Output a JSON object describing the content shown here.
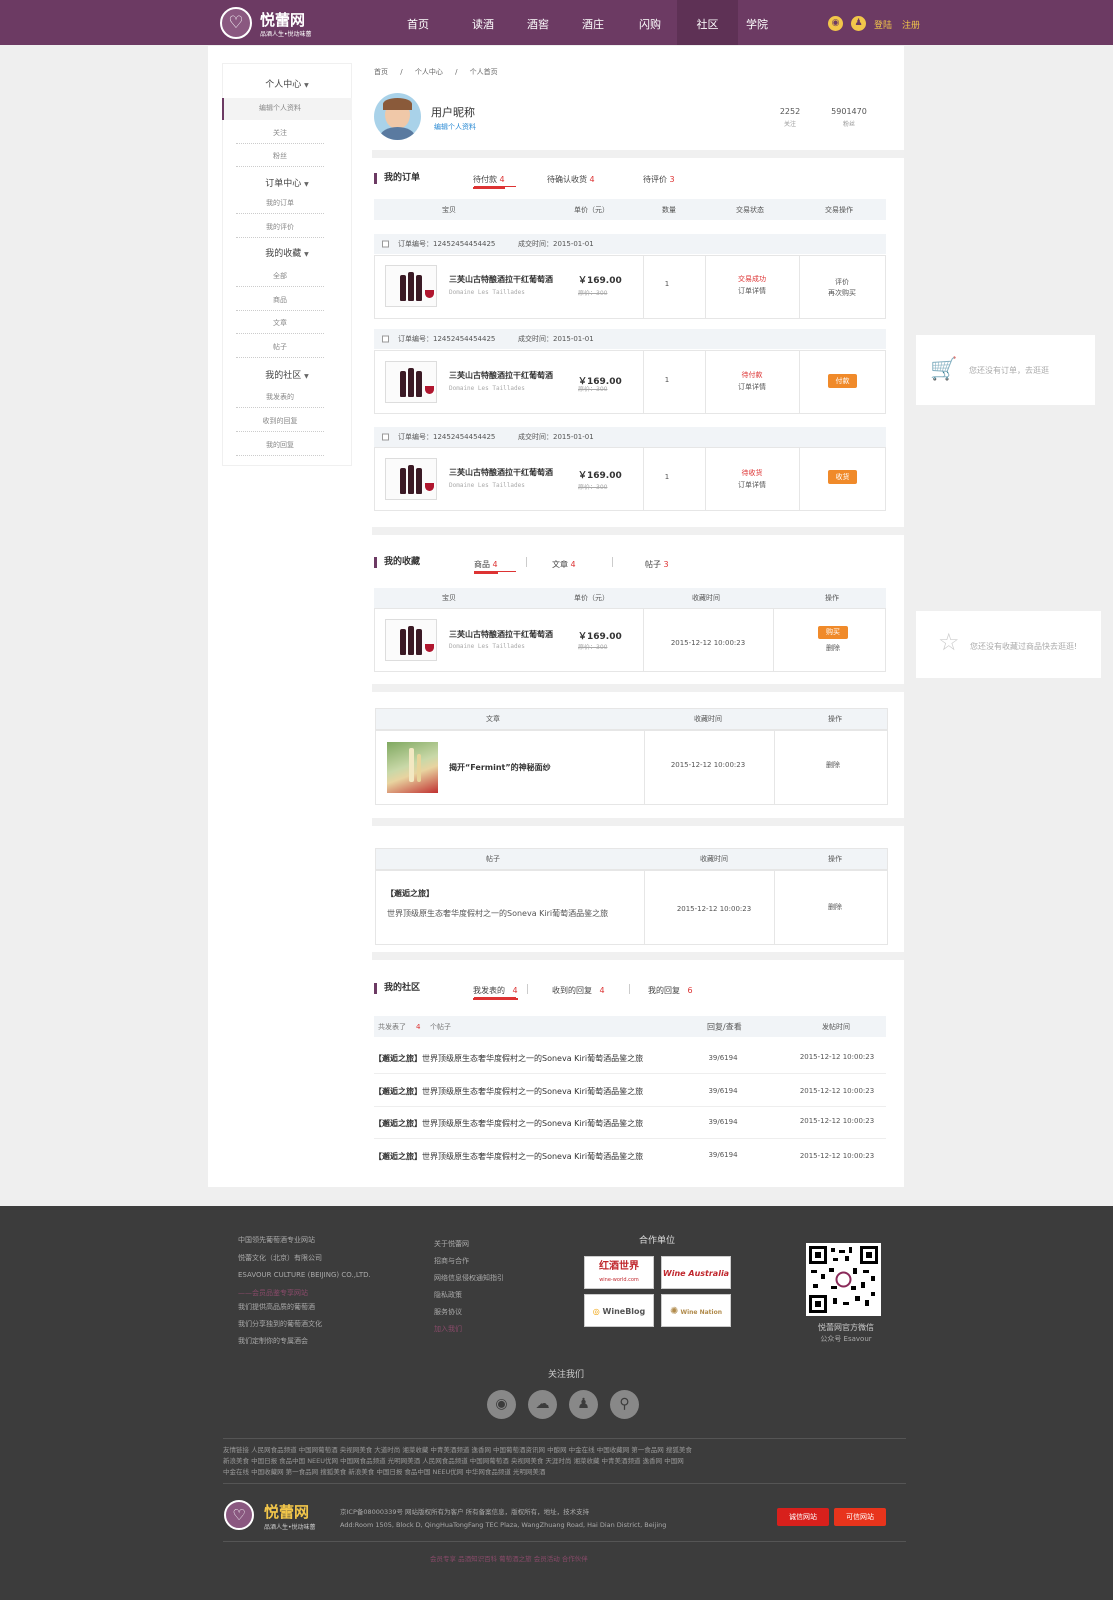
{
  "header": {
    "logo_text": "悦蕾网",
    "logo_slogan": "品酒人生•悦动味蕾",
    "nav": [
      "首页",
      "读酒",
      "酒窖",
      "酒庄",
      "闪购",
      "社区",
      "学院"
    ],
    "active_nav": "社区",
    "login": "登陆",
    "register": "注册"
  },
  "sidebar": {
    "personal_center": "个人中心",
    "personal_items": [
      "编辑个人资料",
      "关注",
      "粉丝"
    ],
    "order_center": "订单中心",
    "order_items": [
      "我的订单",
      "我的评价"
    ],
    "favorites": "我的收藏",
    "favorite_items": [
      "全部",
      "商品",
      "文章",
      "帖子"
    ],
    "community": "我的社区",
    "community_items": [
      "我发表的",
      "收到的回复",
      "我的回复"
    ]
  },
  "breadcrumb": [
    "首页",
    "个人中心",
    "个人首页"
  ],
  "profile": {
    "nickname": "用户昵称",
    "edit_link": "编辑个人资料",
    "follow_count": "2252",
    "follow_label": "关注",
    "fans_count": "5901470",
    "fans_label": "粉丝"
  },
  "orders": {
    "title": "我的订单",
    "tabs": [
      {
        "label": "待付款",
        "count": "4"
      },
      {
        "label": "待确认收货",
        "count": "4"
      },
      {
        "label": "待评价",
        "count": "3"
      }
    ],
    "headers": [
      "宝贝",
      "单价（元）",
      "数量",
      "交易状态",
      "交易操作"
    ],
    "items": [
      {
        "order_no": "订单编号：12452454454425",
        "order_time": "成交时间：2015-01-01",
        "name": "三芙山古特酿酒拉干红葡萄酒",
        "en": "Domaine Les Taillades",
        "price": "￥169.00",
        "orig": "原价：300",
        "qty": "1",
        "status": "交易成功",
        "detail": "订单详情",
        "op1": "评价",
        "op2": "再次购买"
      },
      {
        "order_no": "订单编号：12452454454425",
        "order_time": "成交时间：2015-01-01",
        "name": "三芙山古特酿酒拉干红葡萄酒",
        "en": "Domaine Les Taillades",
        "price": "￥169.00",
        "orig": "原价：300",
        "qty": "1",
        "status": "待付款",
        "detail": "订单详情",
        "button": "付款"
      },
      {
        "order_no": "订单编号：12452454454425",
        "order_time": "成交时间：2015-01-01",
        "name": "三芙山古特酿酒拉干红葡萄酒",
        "en": "Domaine Les Taillades",
        "price": "￥169.00",
        "orig": "原价：300",
        "qty": "1",
        "status": "待收货",
        "detail": "订单详情",
        "button": "收货"
      }
    ],
    "empty_note": "您还没有订单，去逛逛"
  },
  "favorites_sec": {
    "title": "我的收藏",
    "tabs": [
      {
        "label": "商品",
        "count": "4"
      },
      {
        "label": "文章",
        "count": "4"
      },
      {
        "label": "帖子",
        "count": "3"
      }
    ],
    "goods_headers": [
      "宝贝",
      "单价（元）",
      "收藏时间",
      "操作"
    ],
    "goods": {
      "name": "三芙山古特酿酒拉干红葡萄酒",
      "en": "Domaine Les Taillades",
      "price": "￥169.00",
      "orig": "原价：300",
      "time": "2015-12-12  10:00:23",
      "buy": "购买",
      "del": "删除"
    },
    "article_headers": [
      "文章",
      "收藏时间",
      "操作"
    ],
    "article": {
      "title": "揭开“Fermint”的神秘面纱",
      "time": "2015-12-12  10:00:23",
      "del": "删除"
    },
    "post_headers": [
      "帖子",
      "收藏时间",
      "操作"
    ],
    "post": {
      "title": "【邂逅之旅】",
      "text": "世界顶级原生态奢华度假村之一的Soneva Kiri葡萄酒品鉴之旅",
      "time": "2015-12-12  10:00:23",
      "del": "删除"
    },
    "empty_note": "您还没有收藏过商品快去逛逛!"
  },
  "community_sec": {
    "title": "我的社区",
    "tabs": [
      {
        "label": "我发表的",
        "count": "4"
      },
      {
        "label": "收到的回复",
        "count": "4"
      },
      {
        "label": "我的回复",
        "count": "6"
      }
    ],
    "summary_a": "共发表了",
    "summary_n": "4",
    "summary_b": "个帖子",
    "col_reply": "回复/查看",
    "col_time": "发帖时间",
    "rows": [
      {
        "tag": "【邂逅之旅】",
        "text": "世界顶级原生态奢华度假村之一的Soneva Kiri葡萄酒品鉴之旅",
        "stat": "39/6194",
        "time": "2015-12-12  10:00:23"
      },
      {
        "tag": "【邂逅之旅】",
        "text": "世界顶级原生态奢华度假村之一的Soneva Kiri葡萄酒品鉴之旅",
        "stat": "39/6194",
        "time": "2015-12-12  10:00:23"
      },
      {
        "tag": "【邂逅之旅】",
        "text": "世界顶级原生态奢华度假村之一的Soneva Kiri葡萄酒品鉴之旅",
        "stat": "39/6194",
        "time": "2015-12-12  10:00:23"
      },
      {
        "tag": "【邂逅之旅】",
        "text": "世界顶级原生态奢华度假村之一的Soneva Kiri葡萄酒品鉴之旅",
        "stat": "39/6194",
        "time": "2015-12-12  10:00:23"
      }
    ]
  },
  "footer": {
    "about": [
      "中国领先葡萄酒专业网站",
      "悦蕾文化（北京）有限公司",
      "ESAVOUR CULTURE (BEIJING) CO.,LTD."
    ],
    "about_pink": "——会员品鉴专享网站",
    "about_more": [
      "我们提供高品质的葡萄酒",
      "我们分享独到的葡萄酒文化",
      "我们定制你的专属酒会"
    ],
    "links": [
      "关于悦蕾网",
      "招商与合作",
      "网络信息侵权通知指引",
      "隐私政策",
      "服务协议"
    ],
    "links_pink": "加入我们",
    "partners_title": "合作单位",
    "partners": [
      "红酒世界",
      "Wine Australia",
      "WineBlog",
      "Wine Nation"
    ],
    "partner_subs": [
      "wine-world.com"
    ],
    "qr_title": "悦蕾网官方微信",
    "qr_sub": "公众号 Esavour",
    "follow_us": "关注我们",
    "friend_links_1": "友情链接   人民网食品频道     中国网葡萄酒     央视网美食     大道时尚     湘菜收藏     中青美酒频道     逸香网     中国葡萄酒资讯网     中酿网     中金在线     中国收藏网     第一食品网     搜狐美食",
    "friend_links_2": "新浪美食   中国日报     食品中国     NEEU优网     中国网食品频道     光明网美酒     人民网食品频道     中国网葡萄酒     央视网美食     天涯时尚     湘菜收藏     中青美酒频道     逸香网     中国网",
    "friend_links_3": "中金在线     中国收藏网     第一食品网     搜狐美食     新浪美食     中国日报     食品中国     NEEU优网     中华网食品频道     光明网美酒",
    "icp": "京ICP备08000339号 网站版权所有为客户 所有备案信息，版权所有，地址，技术支持",
    "address": "Add:Room 1505, Block D, QingHuaTongFang TEC Plaza, WangZhuang Road, Hai Dian District, Beijing",
    "badge1": "诚信网站",
    "badge2": "可信网站",
    "bottom_links": "会员专享   品酒知识百科   葡萄酒之旅   会员活动   合作伙伴"
  },
  "colors": {
    "brand": "#6c3a63",
    "accent": "#d33333",
    "orange": "#f08a2a"
  }
}
